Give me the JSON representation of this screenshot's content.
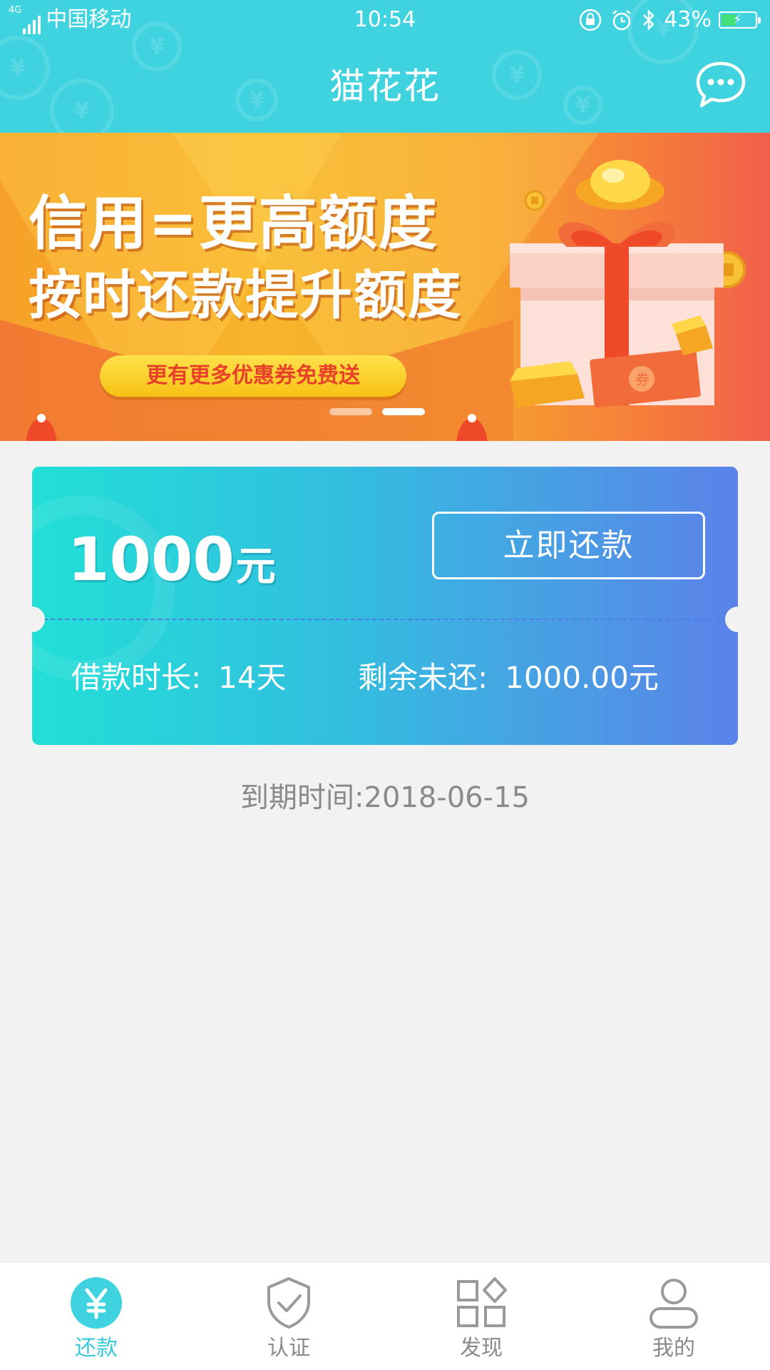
{
  "status_bar": {
    "network": "4G",
    "carrier": "中国移动",
    "time": "10:54",
    "battery": "43%",
    "battery_level": 0.43
  },
  "header": {
    "title": "猫花花",
    "chat_icon": "chat-bubble-icon",
    "color": "#3fd3e0"
  },
  "banner": {
    "line1": "信用=更高额度",
    "line2": "按时还款提升额度",
    "pill": "更有更多优惠券免费送",
    "coupon_text": "券",
    "active_slide": 2,
    "slide_count": 2
  },
  "loan_card": {
    "amount": "1000",
    "amount_unit": "元",
    "repay_button": "立即还款",
    "duration_label": "借款时长:",
    "duration_value": "14天",
    "remaining_label": "剩余未还:",
    "remaining_value": "1000.00元"
  },
  "due_text": "到期时间:2018-06-15",
  "tabs": [
    {
      "label": "还款",
      "icon": "yuan-icon",
      "active": true
    },
    {
      "label": "认证",
      "icon": "shield-check-icon",
      "active": false
    },
    {
      "label": "发现",
      "icon": "grid-icon",
      "active": false
    },
    {
      "label": "我的",
      "icon": "user-icon",
      "active": false
    }
  ],
  "colors": {
    "accent": "#39c9dc",
    "tab_inactive": "#8a8a8a",
    "background": "#f2f2f2"
  }
}
